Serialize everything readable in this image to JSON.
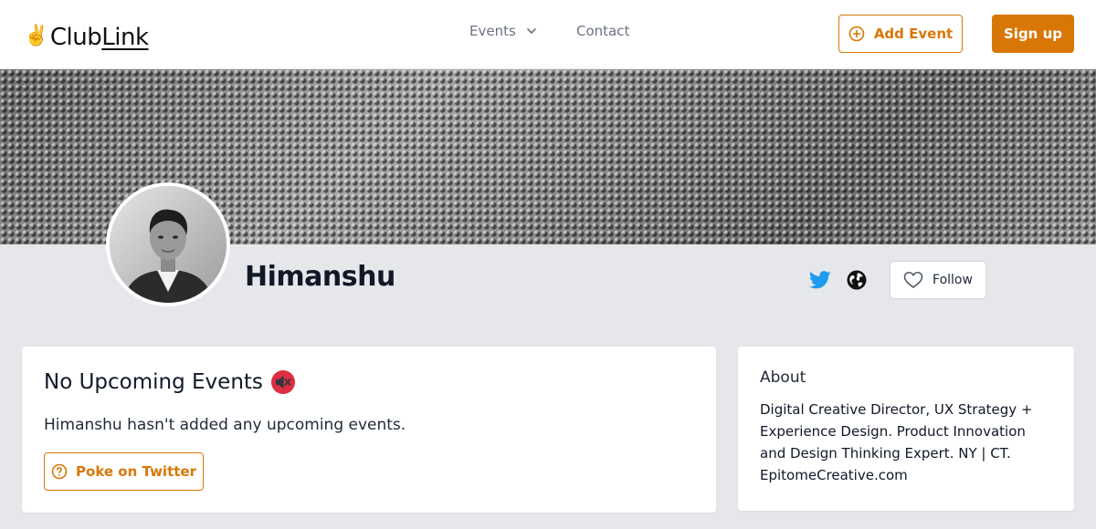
{
  "header": {
    "logo_emoji": "✌️",
    "logo_club": "Club",
    "logo_link": "Link",
    "nav_events": "Events",
    "nav_contact": "Contact",
    "add_event_label": "Add Event",
    "signup_label": "Sign up"
  },
  "profile": {
    "name": "Himanshu",
    "follow_label": "Follow"
  },
  "events": {
    "title": "No Upcoming Events",
    "message": "Himanshu hasn't added any upcoming events.",
    "poke_label": "Poke on Twitter"
  },
  "about": {
    "title": "About",
    "text": "Digital Creative Director, UX Strategy + Experience Design. Product Innovation and Design Thinking Expert. NY | CT. EpitomeCreative.com"
  },
  "colors": {
    "accent": "#d97706",
    "twitter": "#1d9bf0",
    "page_bg": "#e5e7eb"
  },
  "icons": [
    "chevron-down-icon",
    "plus-circle-icon",
    "twitter-icon",
    "globe-icon",
    "heart-icon",
    "mute-icon",
    "question-circle-icon"
  ]
}
